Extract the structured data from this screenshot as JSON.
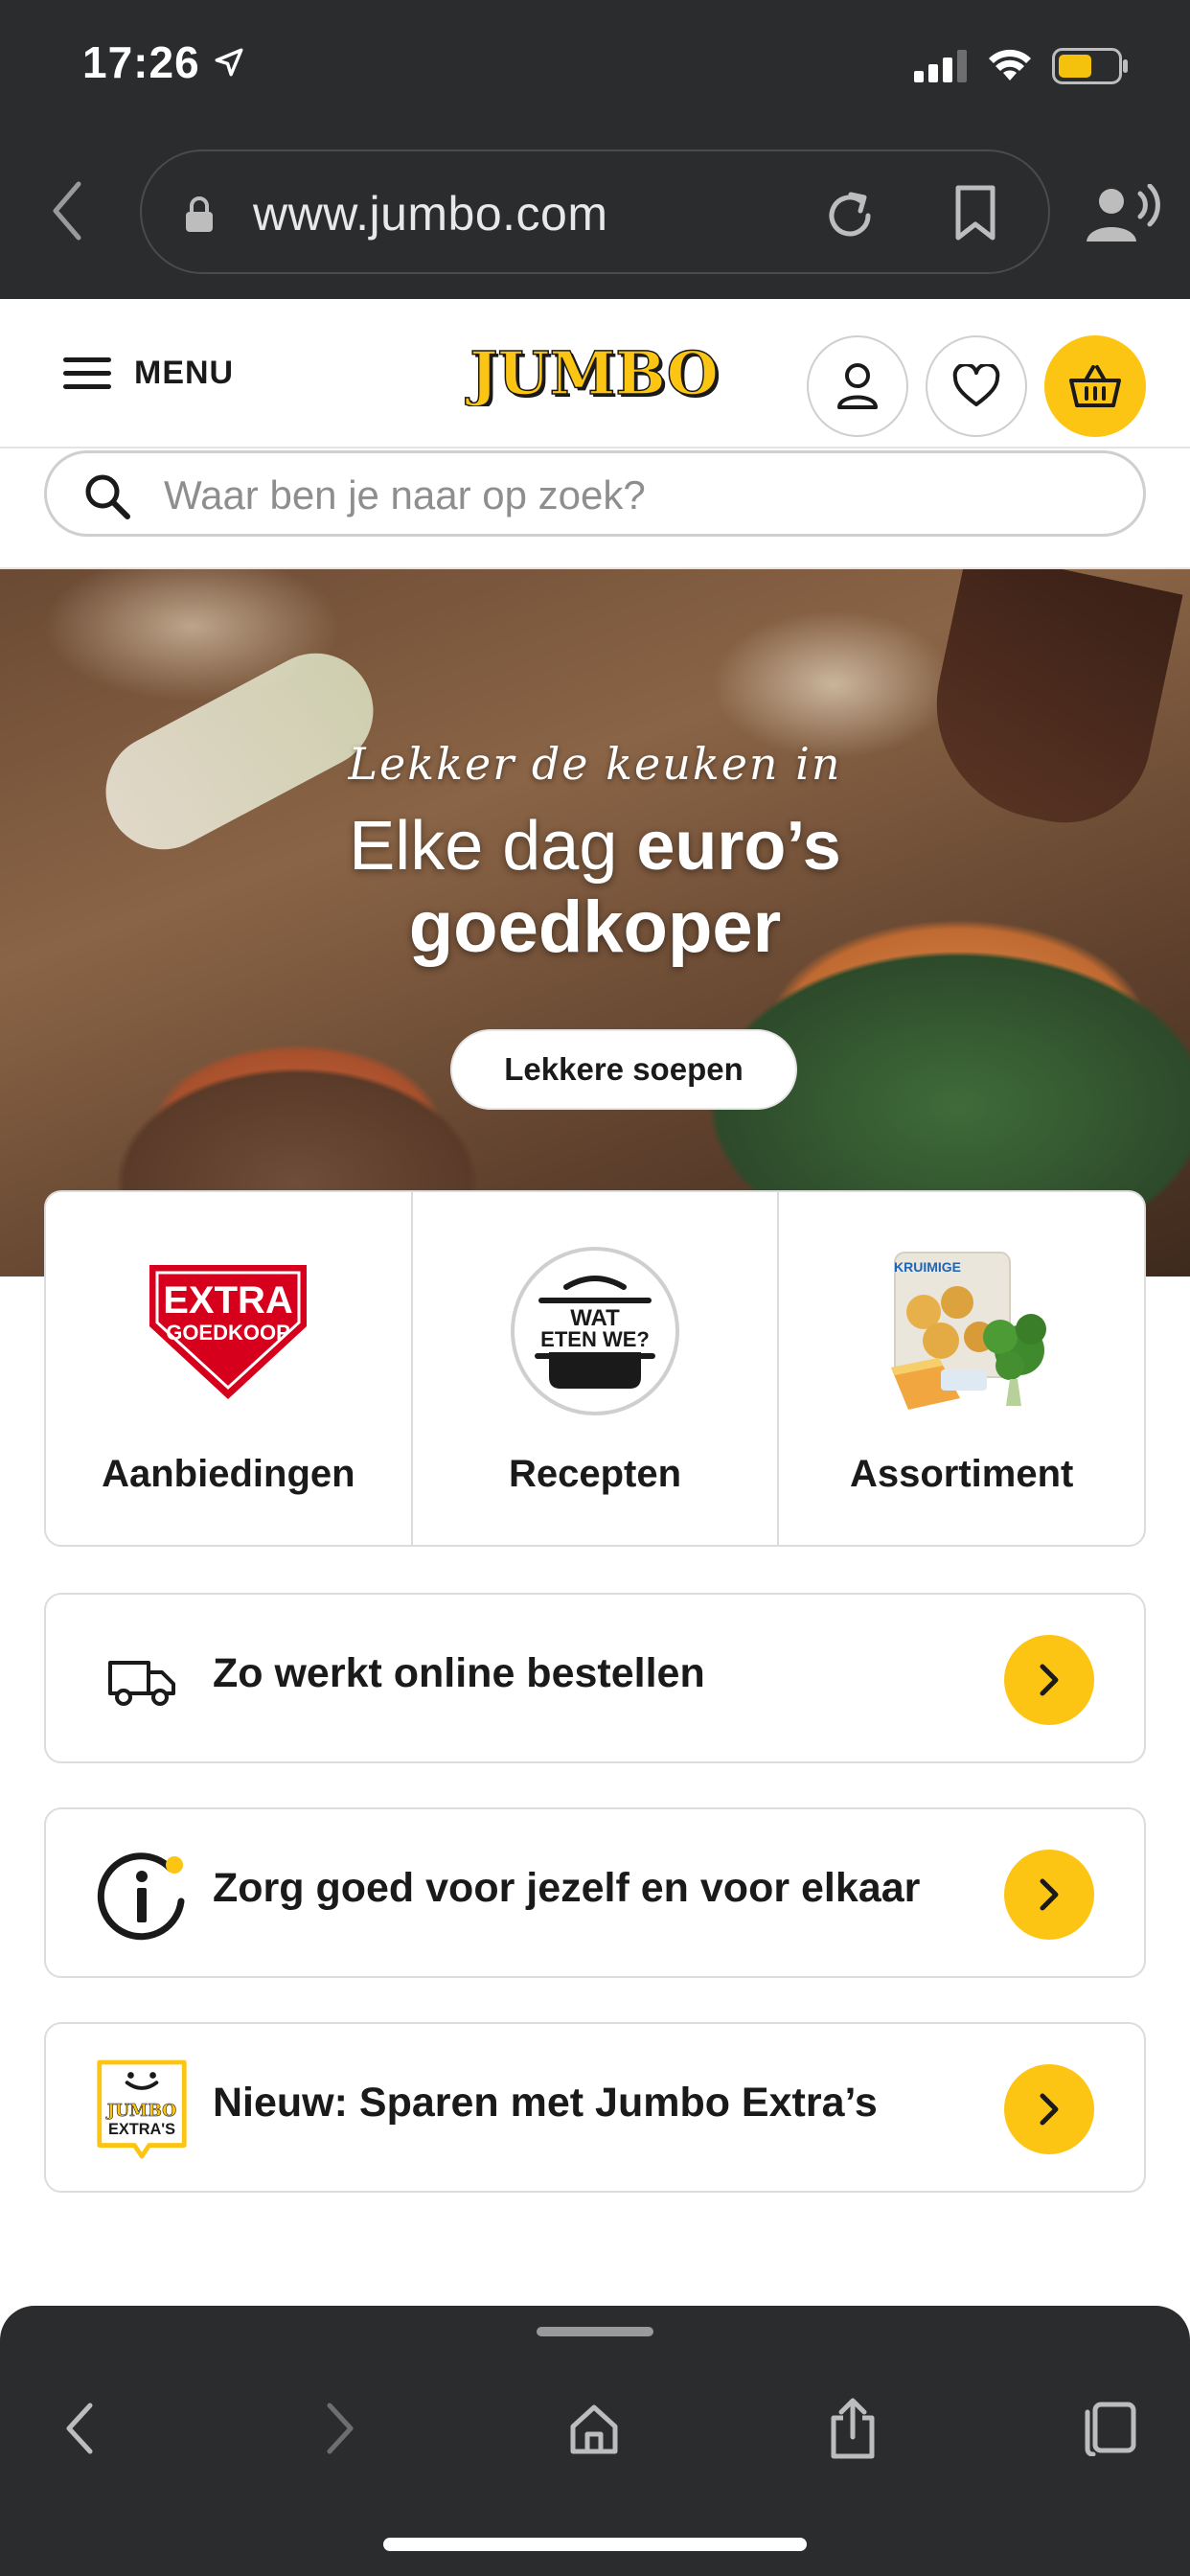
{
  "status_bar": {
    "time": "17:26"
  },
  "browser": {
    "url": "www.jumbo.com"
  },
  "header": {
    "menu_label": "MENU",
    "logo_text": "JUMBO"
  },
  "search": {
    "placeholder": "Waar ben je naar op zoek?"
  },
  "hero": {
    "tagline": "Lekker de keuken in",
    "title_line1_regular": "Elke dag ",
    "title_line1_bold": "euro’s",
    "title_line2": "goedkoper",
    "cta_label": "Lekkere soepen"
  },
  "categories": [
    {
      "label": "Aanbiedingen",
      "badge_line1": "EXTRA",
      "badge_line2": "GOEDKOOP"
    },
    {
      "label": "Recepten",
      "badge_line1": "WAT",
      "badge_line2": "ETEN WE?"
    },
    {
      "label": "Assortiment",
      "badge_line1": "KRUIMIGE"
    }
  ],
  "info_rows": [
    {
      "label": "Zo werkt online bestellen",
      "icon": "truck-icon"
    },
    {
      "label": "Zorg goed voor jezelf en voor elkaar",
      "icon": "info-icon"
    },
    {
      "label": "Nieuw: Sparen met Jumbo Extra’s",
      "icon": "jumbo-extras-icon",
      "icon_line1": "JUMBO",
      "icon_line2": "EXTRA'S"
    }
  ],
  "colors": {
    "brand_yellow": "#fdc513",
    "brand_red": "#d6001c",
    "chrome_dark": "#2b2c2e",
    "text_dark": "#1a1a1a"
  }
}
